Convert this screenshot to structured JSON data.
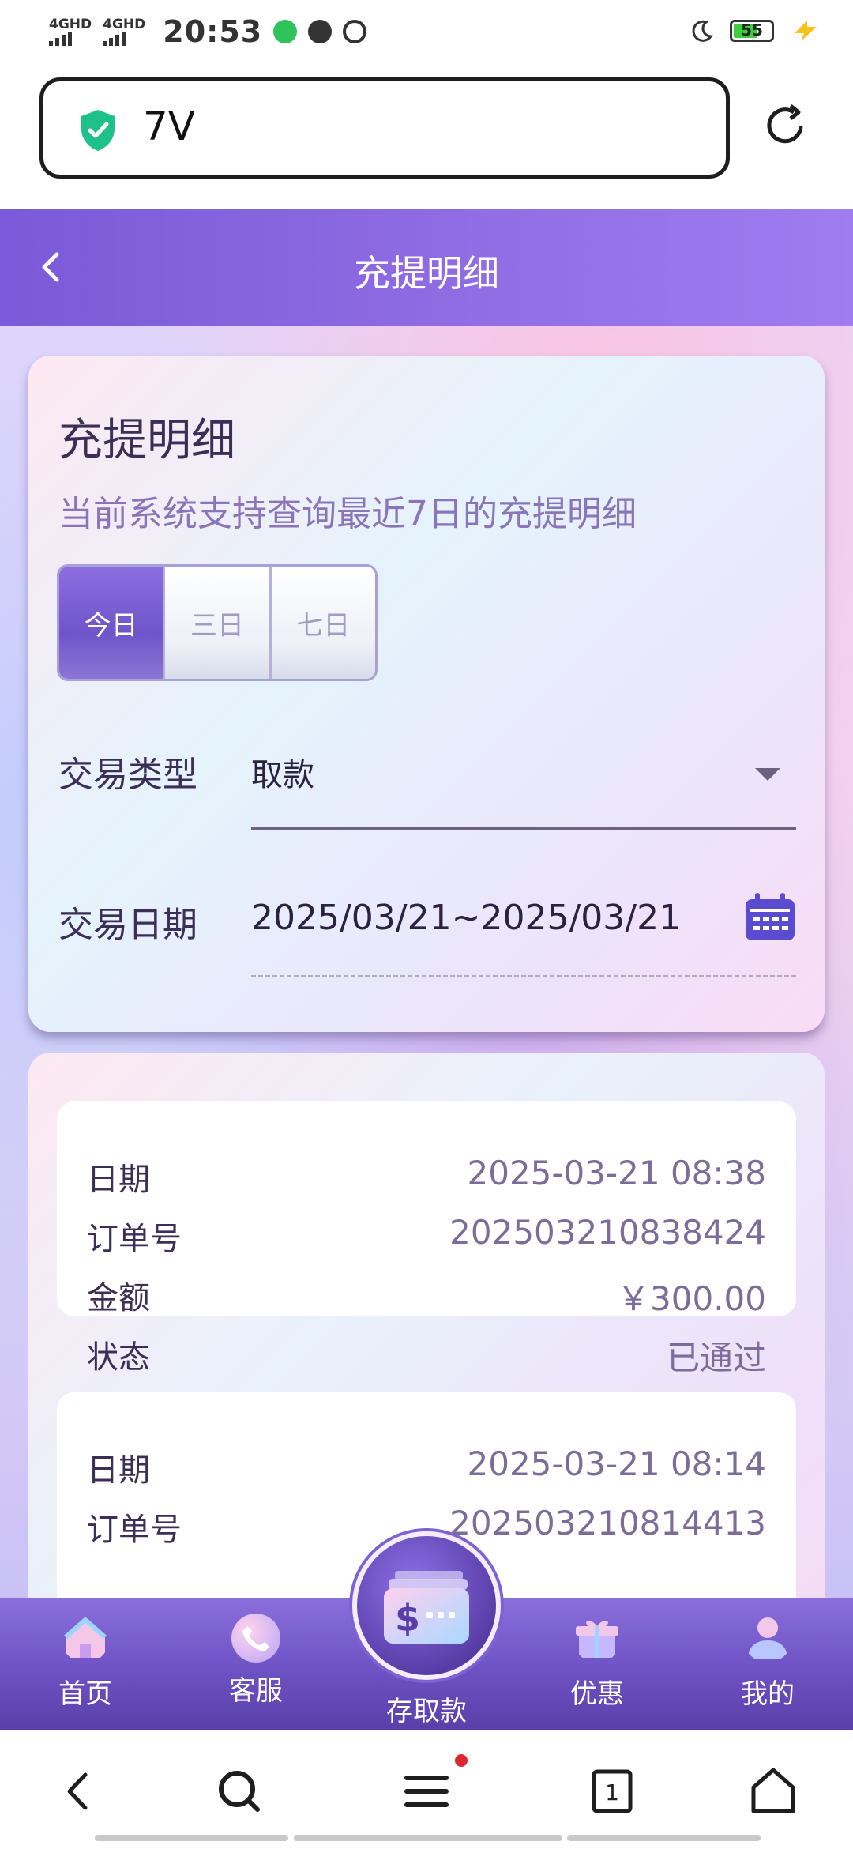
{
  "status_bar": {
    "network_1": "4GHD",
    "network_2": "4GHD",
    "time": "20:53",
    "battery": "55"
  },
  "browser": {
    "url": "7V"
  },
  "header": {
    "title": "充提明细"
  },
  "filter": {
    "title": "充提明细",
    "subtitle": "当前系统支持查询最近7日的充提明细",
    "ranges": [
      "今日",
      "三日",
      "七日"
    ],
    "active_range": "今日",
    "type_label": "交易类型",
    "type_value": "取款",
    "date_label": "交易日期",
    "date_value": "2025/03/21~2025/03/21"
  },
  "records": [
    {
      "date_label": "日期",
      "date": "2025-03-21 08:38",
      "order_label": "订单号",
      "order": "202503210838424",
      "amount_label": "金额",
      "amount": "￥300.00",
      "status_label": "状态",
      "status": "已通过"
    },
    {
      "date_label": "日期",
      "date": "2025-03-21 08:14",
      "order_label": "订单号",
      "order": "202503210814413"
    }
  ],
  "tabbar": {
    "home": "首页",
    "service": "客服",
    "deposit": "存取款",
    "promo": "优惠",
    "mine": "我的"
  },
  "colors": {
    "header_purple": "#8e6be2",
    "tab_purple": "#6e52c4",
    "active_segment": "#7a5ed2",
    "shield_green": "#1fc18a"
  }
}
